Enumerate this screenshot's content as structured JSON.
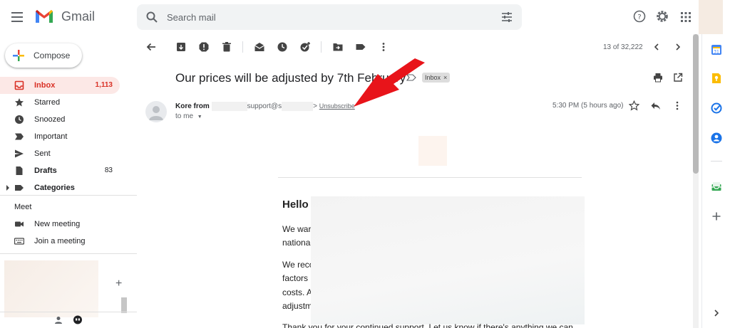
{
  "app": {
    "brand": "Gmail"
  },
  "search": {
    "placeholder": "Search mail"
  },
  "sidebar": {
    "compose_label": "Compose",
    "items": [
      {
        "label": "Inbox",
        "count": "1,113"
      },
      {
        "label": "Starred",
        "count": ""
      },
      {
        "label": "Snoozed",
        "count": ""
      },
      {
        "label": "Important",
        "count": ""
      },
      {
        "label": "Sent",
        "count": ""
      },
      {
        "label": "Drafts",
        "count": "83"
      },
      {
        "label": "Categories",
        "count": ""
      }
    ],
    "meet_title": "Meet",
    "meet_items": [
      {
        "label": "New meeting"
      },
      {
        "label": "Join a meeting"
      }
    ]
  },
  "toolbar": {
    "pager_text": "13 of 32,222"
  },
  "email": {
    "subject": "Our prices will be adjusted by 7th February",
    "label_chip": "Inbox",
    "label_chip_close": "×",
    "sender_name": "Kore from",
    "sender_addr_part": "support@s",
    "sender_addr_end": ">",
    "unsubscribe": "Unsubscribe",
    "to_me": "to me",
    "timestamp": "5:30 PM (5 hours ago)",
    "greeting": "Hello",
    "lines": [
      "We war",
      "nationa",
      "We reco",
      "factors",
      "costs. A",
      "adjustm",
      "Thank you for your continued support. Let us know if there's anything we can"
    ]
  },
  "colors": {
    "inbox_active_bg": "#fce8e6",
    "inbox_active_text": "#d93025",
    "arrow_red": "#e8141a"
  }
}
